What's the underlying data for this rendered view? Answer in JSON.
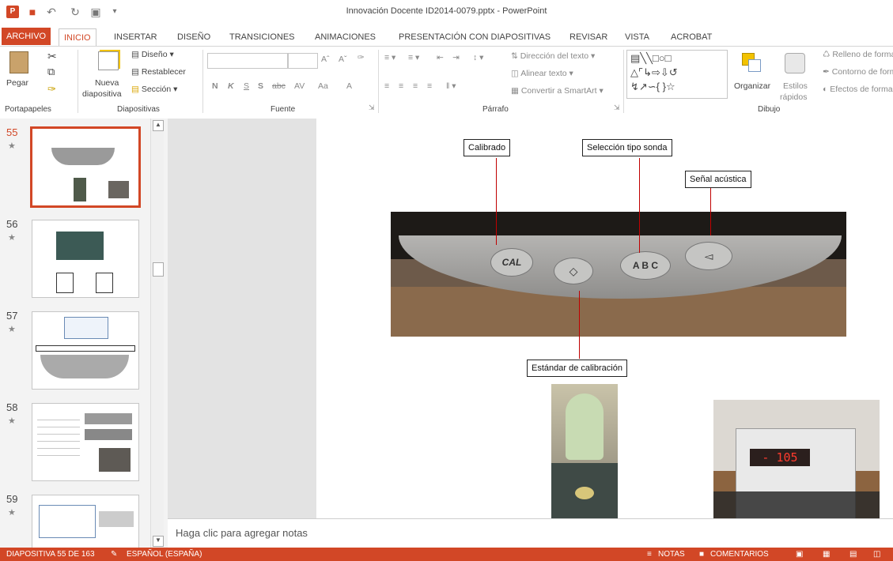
{
  "app": {
    "title": "Innovación Docente ID2014-0079.pptx - PowerPoint",
    "accent": "#d24726"
  },
  "tabs": [
    "ARCHIVO",
    "INICIO",
    "INSERTAR",
    "DISEÑO",
    "TRANSICIONES",
    "ANIMACIONES",
    "PRESENTACIÓN CON DIAPOSITIVAS",
    "REVISAR",
    "VISTA",
    "ACROBAT"
  ],
  "ribbon": {
    "portapapeles": {
      "pegar": "Pegar",
      "label": "Portapapeles"
    },
    "diapositivas": {
      "nueva": "Nueva",
      "nueva2": "diapositiva",
      "diseno": "Diseño",
      "restablecer": "Restablecer",
      "seccion": "Sección",
      "label": "Diapositivas"
    },
    "fuente": {
      "n": "N",
      "k": "K",
      "s": "S",
      "s2": "S",
      "abc": "abc",
      "av": "AV",
      "aa": "Aa",
      "a": "A",
      "label": "Fuente"
    },
    "parrafo": {
      "direccion": "Dirección del texto",
      "alinear": "Alinear texto",
      "convertir": "Convertir a SmartArt",
      "label": "Párrafo"
    },
    "dibujo": {
      "organizar": "Organizar",
      "estilos": "Estilos",
      "rapidos": "rápidos",
      "relleno": "Relleno de forma",
      "contorno": "Contorno de forma",
      "efectos": "Efectos de forma",
      "label": "Dibujo"
    }
  },
  "thumbnails": [
    {
      "number": "55",
      "star": "★"
    },
    {
      "number": "56",
      "star": "★"
    },
    {
      "number": "57",
      "star": "★"
    },
    {
      "number": "58",
      "star": "★"
    },
    {
      "number": "59",
      "star": "★"
    }
  ],
  "slide": {
    "callouts": {
      "calibrado": "Calibrado",
      "seleccion": "Selección tipo sonda",
      "senal": "Señal acústica",
      "estandar": "Estándar de calibración"
    },
    "device_buttons": {
      "cal": "CAL",
      "abc": "A B C"
    },
    "display_value": "- 105"
  },
  "notes": {
    "placeholder": "Haga clic para agregar notas"
  },
  "status": {
    "slide_info": "DIAPOSITIVA 55 DE 163",
    "language": "ESPAÑOL (ESPAÑA)",
    "notas": "NOTAS",
    "comentarios": "COMENTARIOS"
  }
}
